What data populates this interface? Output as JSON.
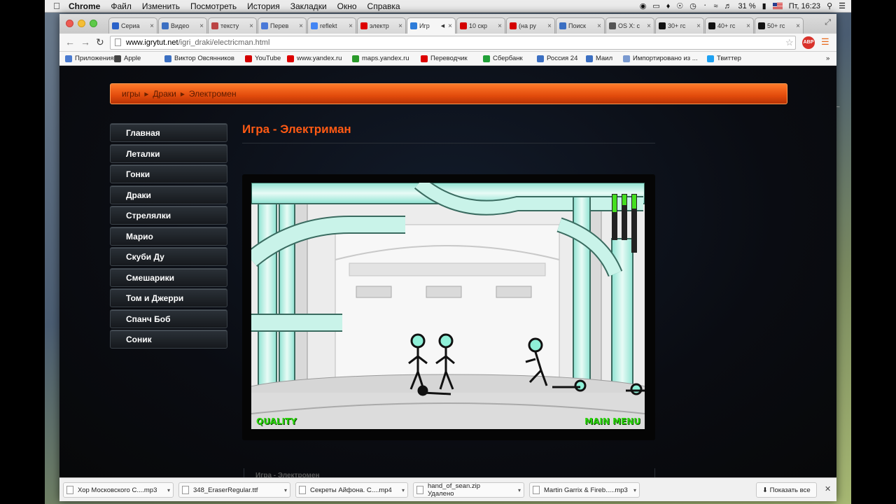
{
  "menubar": {
    "apple": "",
    "app": "Chrome",
    "items": [
      "Файл",
      "Изменить",
      "Посмотреть",
      "История",
      "Закладки",
      "Окно",
      "Справка"
    ],
    "battery": "31 %",
    "clock": "Пт, 16:23"
  },
  "tabs": [
    {
      "title": "Сериа",
      "color": "#2a62c9",
      "icon": "loading-icon"
    },
    {
      "title": "Видео",
      "color": "#3b6fc2",
      "icon": "site-icon"
    },
    {
      "title": "тексту",
      "color": "#b44",
      "icon": "site-icon"
    },
    {
      "title": "Перев",
      "color": "#4a79d8",
      "icon": "diamond-icon"
    },
    {
      "title": "reflekt",
      "color": "#4285f4",
      "icon": "google-icon"
    },
    {
      "title": "электр",
      "color": "#d00",
      "icon": "yandex-icon"
    },
    {
      "title": "Игр",
      "color": "#2d7cd9",
      "icon": "shield-icon"
    },
    {
      "title": "10 скр",
      "color": "#d40000",
      "icon": "youtube-icon"
    },
    {
      "title": "(на ру",
      "color": "#d40000",
      "icon": "youtube-icon"
    },
    {
      "title": "Поиск",
      "color": "#3b6fc2",
      "icon": "site-icon"
    },
    {
      "title": "OS X: с",
      "color": "#555",
      "icon": "apple-icon"
    },
    {
      "title": "30+ гс",
      "color": "#111",
      "icon": "site-icon"
    },
    {
      "title": "40+ гс",
      "color": "#111",
      "icon": "site-icon"
    },
    {
      "title": "50+ гс",
      "color": "#111",
      "icon": "site-icon"
    }
  ],
  "address": {
    "host": "www.igrytut.net",
    "path": "/igri_draki/electricman.html"
  },
  "bookmarks": [
    {
      "label": "Приложения",
      "color": "#4a7bd0"
    },
    {
      "label": "Apple",
      "color": "#444"
    },
    {
      "label": "Виктор Овсянников",
      "color": "#3b6fc2"
    },
    {
      "label": "YouTube",
      "color": "#d40000"
    },
    {
      "label": "www.yandex.ru",
      "color": "#d00"
    },
    {
      "label": "maps.yandex.ru",
      "color": "#2a9a2a"
    },
    {
      "label": "Переводчик",
      "color": "#d00"
    },
    {
      "label": "Сбербанк",
      "color": "#21a038"
    },
    {
      "label": "Россия 24",
      "color": "#3b6fc2"
    },
    {
      "label": "Маил",
      "color": "#3b6fc2"
    },
    {
      "label": "Импортировано из ...",
      "color": "#7a9ad0"
    },
    {
      "label": "Твиттер",
      "color": "#1da1f2"
    }
  ],
  "breadcrumb": [
    "игры",
    "Драки",
    "Электромен"
  ],
  "sidebar": [
    "Главная",
    "Леталки",
    "Гонки",
    "Драки",
    "Стрелялки",
    "Марио",
    "Скуби Ду",
    "Смешарики",
    "Том и Джерри",
    "Спанч Боб",
    "Соник"
  ],
  "page_title": "Игра - Электриман",
  "game": {
    "quality": "QUALITY",
    "main_menu": "MAIN MENU",
    "health_levels": [
      0.25,
      0.15,
      0.2
    ]
  },
  "below_title": "Игра - Электромен",
  "downloads": [
    {
      "name": "Хор Московского С....mp3",
      "status": ""
    },
    {
      "name": "348_EraserRegular.ttf",
      "status": ""
    },
    {
      "name": "Секреты Айфона. С....mp4",
      "status": ""
    },
    {
      "name": "hand_of_sean.zip",
      "status": "Удалено"
    },
    {
      "name": "Martin Garrix & Fireb.....mp3",
      "status": ""
    }
  ],
  "show_all": "Показать все"
}
